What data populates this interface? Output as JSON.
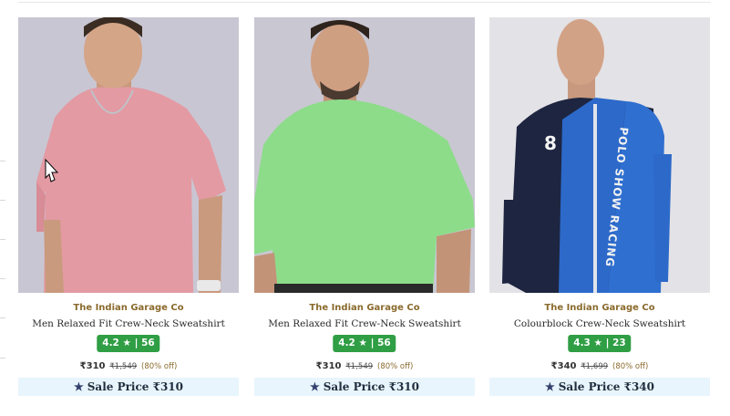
{
  "products": [
    {
      "brand": "The Indian Garage Co",
      "title": "Men Relaxed Fit Crew-Neck Sweatshirt",
      "rating": "4.2",
      "reviews": "56",
      "price": "₹310",
      "mrp": "₹1,549",
      "discount": "(80% off)",
      "sale_label": "Sale Price ₹310",
      "image_icon": "pink-tshirt-model-image"
    },
    {
      "brand": "The Indian Garage Co",
      "title": "Men Relaxed Fit Crew-Neck Sweatshirt",
      "rating": "4.2",
      "reviews": "56",
      "price": "₹310",
      "mrp": "₹1,549",
      "discount": "(80% off)",
      "sale_label": "Sale Price ₹310",
      "image_icon": "green-tshirt-model-image"
    },
    {
      "brand": "The Indian Garage Co",
      "title": "Colourblock Crew-Neck Sweatshirt",
      "rating": "4.3",
      "reviews": "23",
      "price": "₹340",
      "mrp": "₹1,699",
      "discount": "(80% off)",
      "sale_label": "Sale Price ₹340",
      "image_icon": "colourblock-sweatshirt-model-image",
      "print_text": "POLO SHOW RACING",
      "number_print": "8"
    }
  ],
  "colors": {
    "rating_badge": "#2f9e44",
    "brand_text": "#8a6a2c",
    "sale_bar": "#e8f5fd"
  }
}
